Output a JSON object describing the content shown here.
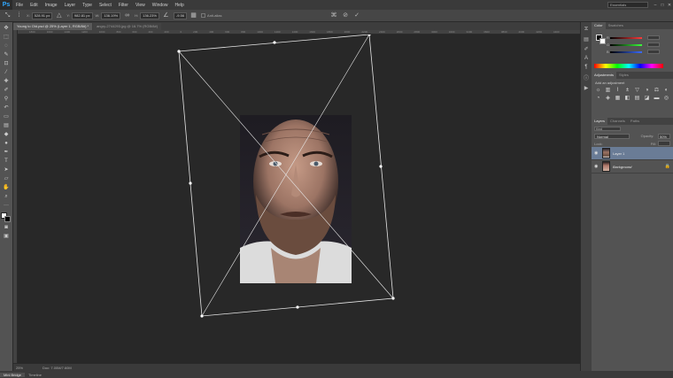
{
  "app": {
    "logo": "Ps"
  },
  "menu": [
    "File",
    "Edit",
    "Image",
    "Layer",
    "Type",
    "Select",
    "Filter",
    "View",
    "Window",
    "Help"
  ],
  "workspace": "Essentials",
  "window_controls": {
    "minimize": "–",
    "maximize": "□",
    "close": "✕"
  },
  "options_bar": {
    "x_value": "528.91 px",
    "y_value": "982.81 px",
    "w_value": "136.19%",
    "h_value": "136.23%",
    "angle_value": "-9.56",
    "anti_alias_label": "Anti-alias"
  },
  "document_tabs": [
    {
      "label": "Young to Old.psd @ 25% (Layer 1, RGB/8#) *",
      "active": true
    },
    {
      "label": "angry-2744293.jpg @ 16.7% (RGB/8#)",
      "active": false
    }
  ],
  "ruler_ticks": [
    "1800",
    "1600",
    "1400",
    "1200",
    "1000",
    "800",
    "600",
    "400",
    "200",
    "0",
    "200",
    "400",
    "600",
    "800",
    "1000",
    "1200",
    "1400",
    "1600",
    "1800",
    "2000",
    "2200",
    "2400",
    "2600",
    "2800",
    "3000",
    "3200",
    "3400",
    "3600",
    "3800",
    "4000",
    "4200",
    "4400"
  ],
  "status_bar": {
    "zoom": "25%",
    "doc_info": "Doc: 7.00M/7.60M"
  },
  "bottom_tabs": [
    {
      "label": "Mini Bridge",
      "active": true
    },
    {
      "label": "Timeline",
      "active": false
    }
  ],
  "color_panel": {
    "tabs": [
      "Color",
      "Swatches"
    ],
    "sliders": [
      {
        "label": "R",
        "color": "#ff3b3b"
      },
      {
        "label": "G",
        "color": "#3bff3b"
      },
      {
        "label": "B",
        "color": "#3b6bff"
      }
    ]
  },
  "adjustments_panel": {
    "tabs": [
      "Adjustments",
      "Styles"
    ],
    "title": "Add an adjustment",
    "icons": [
      "brightness-icon",
      "levels-icon",
      "curves-icon",
      "exposure-icon",
      "vibrance-icon",
      "hue-icon",
      "color-balance-icon",
      "bw-icon",
      "photo-filter-icon",
      "channel-mixer-icon",
      "lookup-icon",
      "invert-icon",
      "posterize-icon",
      "threshold-icon",
      "gradient-map-icon",
      "selective-color-icon"
    ],
    "glyphs": [
      "☼",
      "▥",
      "⌇",
      "±",
      "▽",
      "◑",
      "⚖",
      "◐",
      "◔",
      "◈",
      "▦",
      "◧",
      "▤",
      "◪",
      "▬",
      "◎"
    ]
  },
  "layers_panel": {
    "tabs": [
      "Layers",
      "Channels",
      "Paths"
    ],
    "filter_kind": "Kind",
    "blend_mode": "Normal",
    "opacity_label": "Opacity:",
    "opacity_value": "50%",
    "lock_label": "Lock:",
    "fill_label": "Fill:",
    "layers": [
      {
        "name": "Layer 1",
        "selected": true
      },
      {
        "name": "Background",
        "selected": false,
        "locked": true
      }
    ]
  },
  "colors": {
    "accent": "#31a8ff",
    "selected_layer": "#6a7c96"
  }
}
